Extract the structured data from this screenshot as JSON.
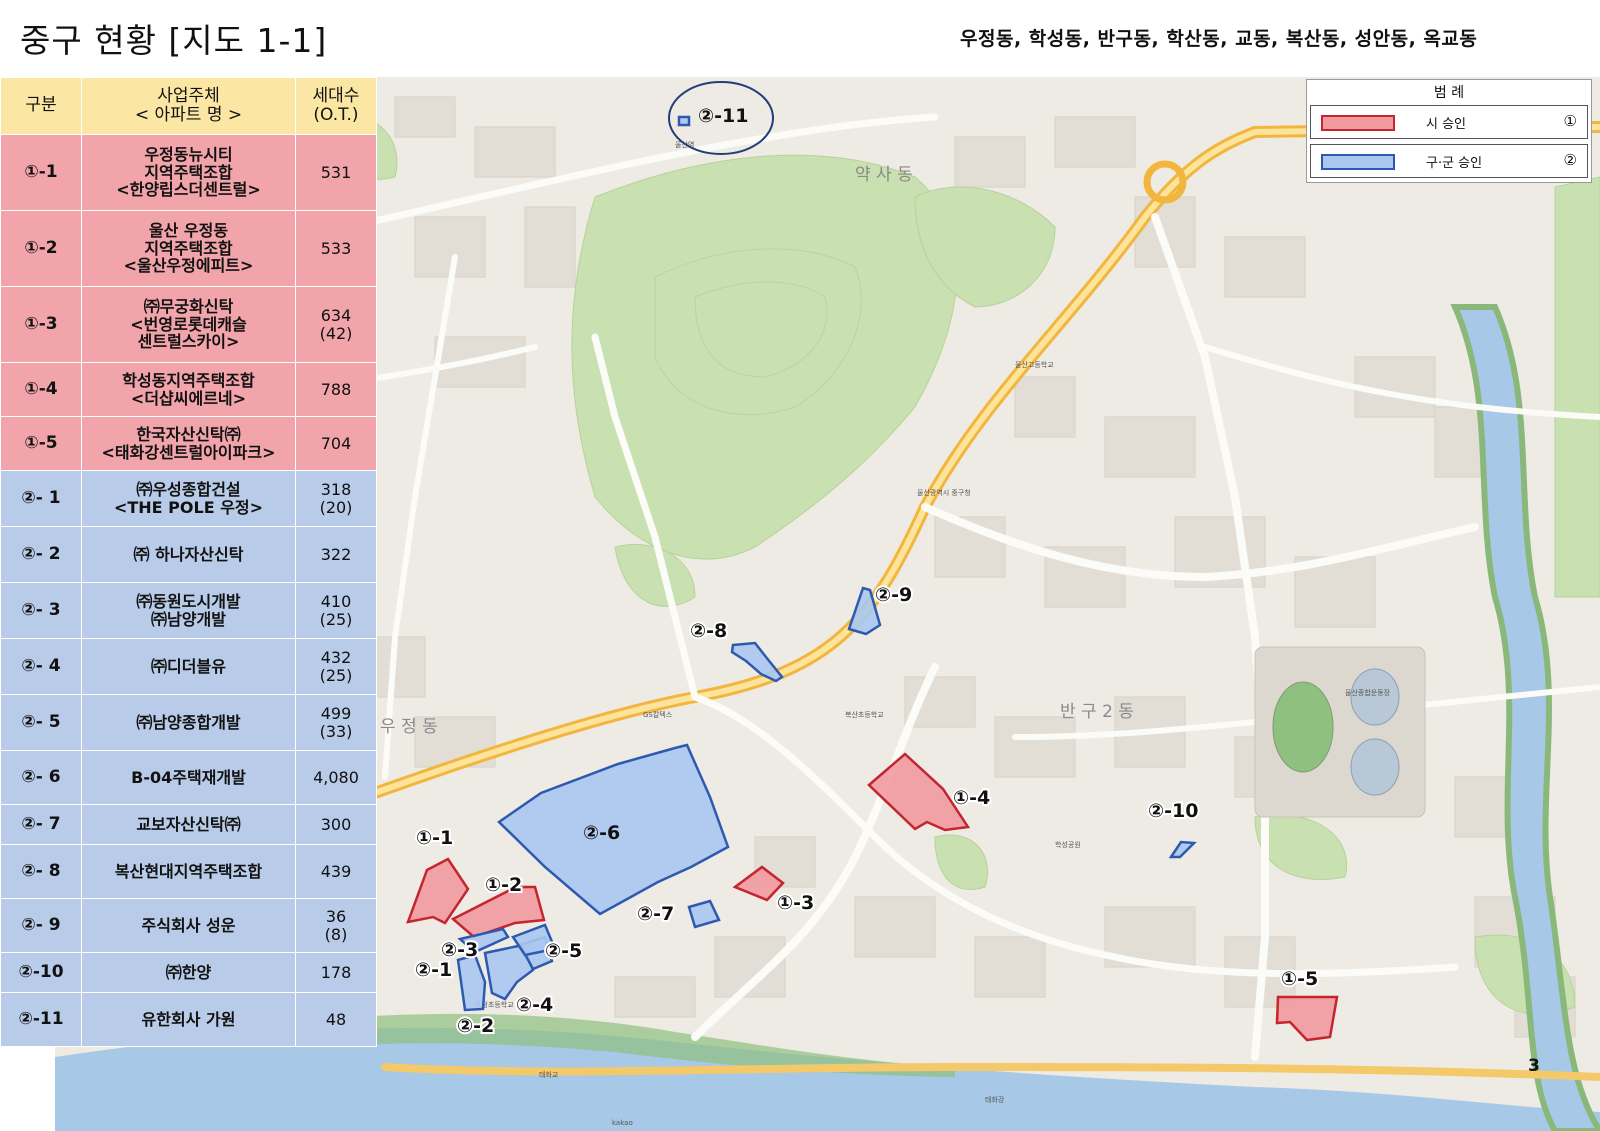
{
  "title": "중구 현황 [지도 1-1]",
  "dong_list": "우정동,  학성동,  반구동,  학산동,  교동,  복산동,  성안동,  옥교동",
  "page_number": "3",
  "legend": {
    "title": "범 례",
    "items": [
      {
        "label": "시 승인",
        "mark": "①",
        "fill": "#f19aa0",
        "stroke": "#c4252e"
      },
      {
        "label": "구·군 승인",
        "mark": "②",
        "fill": "#a9c8ef",
        "stroke": "#2d59b0"
      }
    ]
  },
  "table": {
    "headers": {
      "col1": "구분",
      "col2_line1": "사업주체",
      "col2_line2": "< 아파트 명 >",
      "col3_line1": "세대수",
      "col3_line2": "(O.T.)"
    },
    "rows": [
      {
        "code": "①-1",
        "lines": [
          "우정동뉴시티",
          "지역주택조합",
          "<한양립스더센트럴>"
        ],
        "units": [
          "531"
        ],
        "group": "red"
      },
      {
        "code": "①-2",
        "lines": [
          "울산 우정동",
          "지역주택조합",
          "<울산우정에피트>"
        ],
        "units": [
          "533"
        ],
        "group": "red"
      },
      {
        "code": "①-3",
        "lines": [
          "㈜무궁화신탁",
          "<번영로롯데캐슬",
          "센트럴스카이>"
        ],
        "units": [
          "634",
          "(42)"
        ],
        "group": "red"
      },
      {
        "code": "①-4",
        "lines": [
          "학성동지역주택조합",
          "<더샵씨에르네>"
        ],
        "units": [
          "788"
        ],
        "group": "red"
      },
      {
        "code": "①-5",
        "lines": [
          "한국자산신탁㈜",
          "<태화강센트럴아이파크>"
        ],
        "units": [
          "704"
        ],
        "group": "red"
      },
      {
        "code": "②- 1",
        "lines": [
          "㈜우성종합건설",
          "<THE POLE 우정>"
        ],
        "units": [
          "318",
          "(20)"
        ],
        "group": "blue"
      },
      {
        "code": "②- 2",
        "lines": [
          "㈜ 하나자산신탁"
        ],
        "units": [
          "322"
        ],
        "group": "blue"
      },
      {
        "code": "②- 3",
        "lines": [
          "㈜동원도시개발",
          "㈜남양개발"
        ],
        "units": [
          "410",
          "(25)"
        ],
        "group": "blue"
      },
      {
        "code": "②- 4",
        "lines": [
          "㈜디더블유"
        ],
        "units": [
          "432",
          "(25)"
        ],
        "group": "blue"
      },
      {
        "code": "②- 5",
        "lines": [
          "㈜남양종합개발"
        ],
        "units": [
          "499",
          "(33)"
        ],
        "group": "blue"
      },
      {
        "code": "②- 6",
        "lines": [
          "B-04주택재개발"
        ],
        "units": [
          "4,080"
        ],
        "group": "blue"
      },
      {
        "code": "②- 7",
        "lines": [
          "교보자산신탁㈜"
        ],
        "units": [
          "300"
        ],
        "group": "blue"
      },
      {
        "code": "②- 8",
        "lines": [
          "복산현대지역주택조합"
        ],
        "units": [
          "439"
        ],
        "group": "blue"
      },
      {
        "code": "②- 9",
        "lines": [
          "주식회사 성운"
        ],
        "units": [
          "36",
          "(8)"
        ],
        "group": "blue"
      },
      {
        "code": "②-10",
        "lines": [
          "㈜한양"
        ],
        "units": [
          "178"
        ],
        "group": "blue"
      },
      {
        "code": "②-11",
        "lines": [
          "유한회사 가원"
        ],
        "units": [
          "48"
        ],
        "group": "blue"
      }
    ]
  },
  "map": {
    "district_labels": [
      "약 사 동",
      "반 구 2 동",
      "우 정 동"
    ],
    "site_labels": {
      "s1_1": "①-1",
      "s1_2": "①-2",
      "s1_3": "①-3",
      "s1_4": "①-4",
      "s1_5": "①-5",
      "s2_1": "②-1",
      "s2_2": "②-2",
      "s2_3": "②-3",
      "s2_4": "②-4",
      "s2_5": "②-5",
      "s2_6": "②-6",
      "s2_7": "②-7",
      "s2_8": "②-8",
      "s2_9": "②-9",
      "s2_10": "②-10",
      "s2_11": "②-11"
    },
    "poi": {
      "ulsan_station": "울산역",
      "junggu_office": "울산광역시 중구청",
      "taehwa_river": "태화강",
      "taehwa_bridge": "태화교",
      "ulsan_complex": "울산종합운동장",
      "gs_caltex": "GS칼텍스",
      "hakseong_park": "학성공원",
      "bokan_school": "복산초등학교",
      "ujeong_school": "우정초등학교",
      "ulsan_high": "울산고등학교",
      "kakao": "kakao"
    }
  }
}
